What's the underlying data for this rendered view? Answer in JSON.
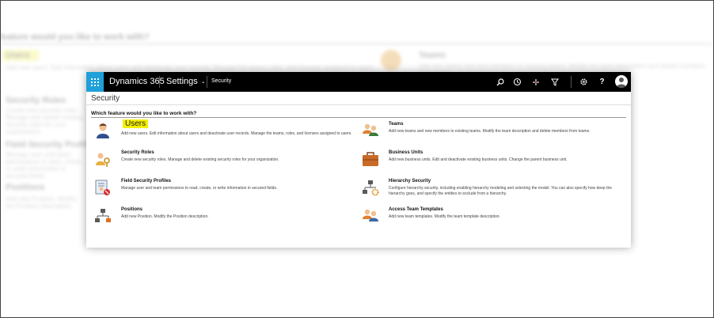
{
  "background": {
    "question": "feature would you like to work with?",
    "items": [
      {
        "title": "Users",
        "desc": "Add new users. Edit information about users and deactivate user records. Manage the teams, roles, and licenses assigned to users."
      },
      {
        "title": "Security Roles",
        "desc": "Create new security roles. Manage and delete existing security roles for your organization."
      },
      {
        "title": "Field Security Profiles",
        "desc": "Manage user and team permissions to read, create, or write information in secured fields."
      },
      {
        "title": "Positions",
        "desc": "Add new Position. Modify the Position description."
      },
      {
        "title": "Teams",
        "desc": "Add new teams and new members to existing teams. Modify the team description and delete members from teams."
      }
    ]
  },
  "nav": {
    "brand": "Dynamics 365",
    "area": "Settings",
    "breadcrumb": "Security"
  },
  "page": {
    "title": "Security",
    "question": "Which feature would you like to work with?"
  },
  "features": {
    "left": [
      {
        "title": "Users",
        "desc": "Add new users. Edit information about users and deactivate user records. Manage the teams, roles, and licenses assigned to users.",
        "icon": "users-icon"
      },
      {
        "title": "Security Roles",
        "desc": "Create new security roles. Manage and delete existing security roles for your organization.",
        "icon": "security-roles-icon"
      },
      {
        "title": "Field Security Profiles",
        "desc": "Manage user and team permissions to read, create, or write information in secured fields.",
        "icon": "field-security-icon"
      },
      {
        "title": "Positions",
        "desc": "Add new Position. Modify the Position description.",
        "icon": "positions-icon"
      }
    ],
    "right": [
      {
        "title": "Teams",
        "desc": "Add new teams and new members to existing teams. Modify the team description and delete members from teams.",
        "icon": "teams-icon"
      },
      {
        "title": "Business Units",
        "desc": "Add new business units. Edit and deactivate existing business units. Change the parent business unit.",
        "icon": "business-units-icon"
      },
      {
        "title": "Hierarchy Security",
        "desc": "Configure hierarchy security, including enabling hierarchy modeling and selecting the model. You can also specify how deep the hierarchy goes, and specify the entities to exclude from a hierarchy.",
        "icon": "hierarchy-security-icon"
      },
      {
        "title": "Access Team Templates",
        "desc": "Add new team templates. Modify the team template description.",
        "icon": "access-team-templates-icon"
      }
    ]
  },
  "colors": {
    "nav_bg": "#000000",
    "waffle_bg": "#1fa0d8",
    "highlight": "#f4f000"
  }
}
